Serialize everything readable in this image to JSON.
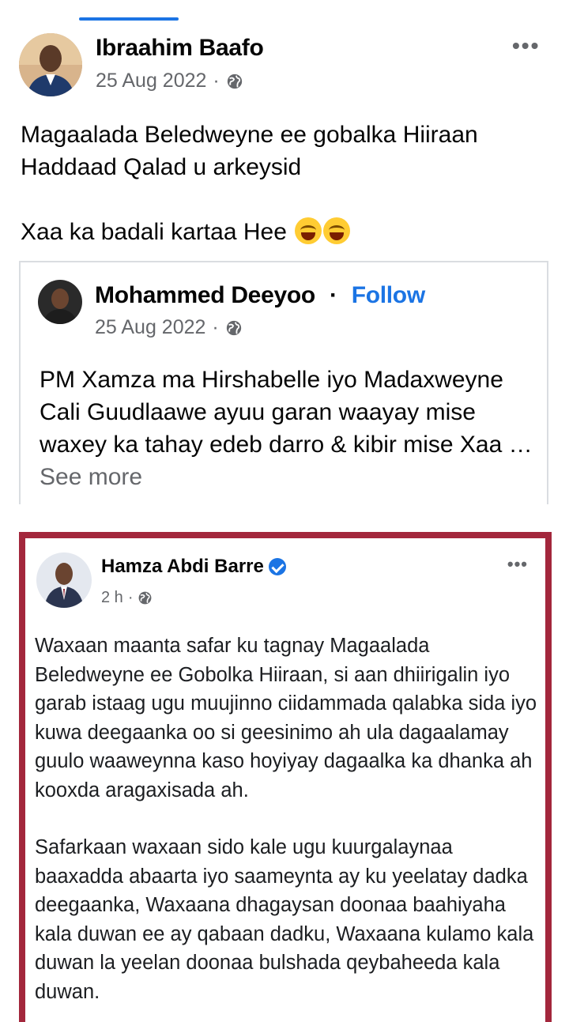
{
  "post": {
    "author": "Ibraahim Baafo",
    "date": "25 Aug 2022",
    "meta_sep": "·",
    "more_label": "•••",
    "text_lines": [
      "Magaalada Beledweyne ee gobalka Hiiraan",
      "Haddaad Qalad u arkeysid"
    ],
    "text_line3": "Xaa ka badali kartaa Hee"
  },
  "shared": {
    "author": "Mohammed Deeyoo",
    "sep": "·",
    "follow_label": "Follow",
    "date": "25 Aug 2022",
    "meta_sep": "·",
    "text": "PM Xamza ma Hirshabelle iyo Madaxweyne Cali Guudlaawe ayuu garan waayay mise waxey ka tahay edeb darro & kibir mise Xaa ka badali kartaa",
    "see_more": "See more"
  },
  "screenshot": {
    "author": "Hamza Abdi Barre",
    "time": "2 h",
    "meta_sep": "·",
    "more_label": "•••",
    "paragraph1": "Waxaan maanta safar ku tagnay Magaalada Beledweyne ee Gobolka Hiiraan, si aan dhiirigalin iyo garab istaag ugu muujinno ciidammada qalabka sida iyo kuwa deegaanka oo si geesinimo ah ula dagaalamay guulo waaweynna kaso hoyiyay dagaalka ka dhanka ah kooxda aragaxisada ah.",
    "paragraph2": "Safarkaan waxaan sido kale ugu kuurgalaynaa baaxadda abaarta iyo saameynta ay ku yeelatay dadka deegaanka, Waxaana dhagaysan doonaa baahiyaha kala duwan ee ay qabaan dadku, Waxaana kulamo kala duwan la yeelan doonaa bulshada qeybaheeda kala duwan."
  },
  "colors": {
    "accent": "#1b74e4",
    "frame": "#a3273c",
    "muted": "#65676b"
  }
}
